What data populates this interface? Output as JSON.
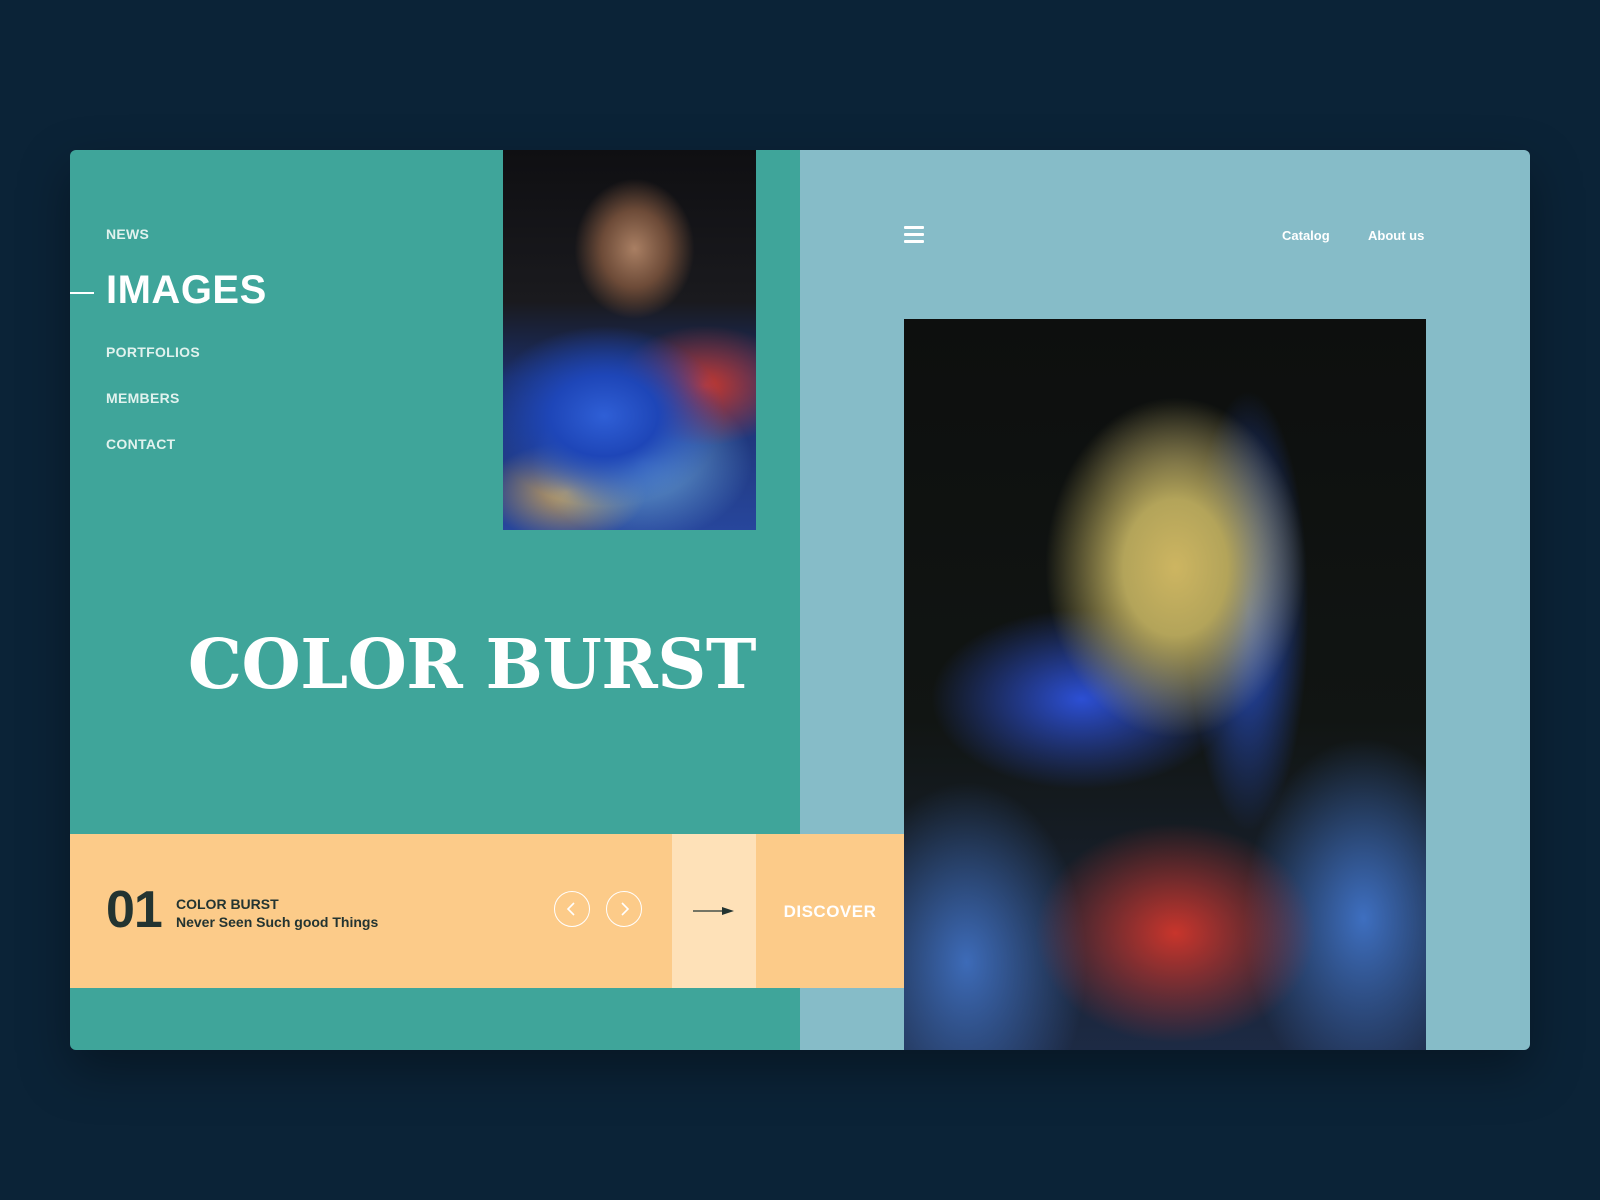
{
  "nav": {
    "items": [
      {
        "label": "NEWS",
        "active": false
      },
      {
        "label": "IMAGES",
        "active": true
      },
      {
        "label": "PORTFOLIOS",
        "active": false
      },
      {
        "label": "MEMBERS",
        "active": false
      },
      {
        "label": "CONTACT",
        "active": false
      }
    ]
  },
  "hero": {
    "title": "COLOR BURST"
  },
  "slide": {
    "number": "01",
    "title": "COLOR BURST",
    "subtitle": "Never Seen Such good Things",
    "cta_label": "DISCOVER"
  },
  "header": {
    "links": [
      "Catalog",
      "About us"
    ]
  },
  "icons": {
    "menu": "hamburger-icon",
    "prev": "chevron-left-icon",
    "next": "chevron-right-icon",
    "cta": "arrow-right-icon"
  },
  "colors": {
    "background": "#0b2337",
    "left_panel": "#3fa59a",
    "right_panel": "#86bcc8",
    "slider_bar": "#fccb89",
    "arrow_box": "#fee1b8",
    "dark_text": "#233431"
  }
}
